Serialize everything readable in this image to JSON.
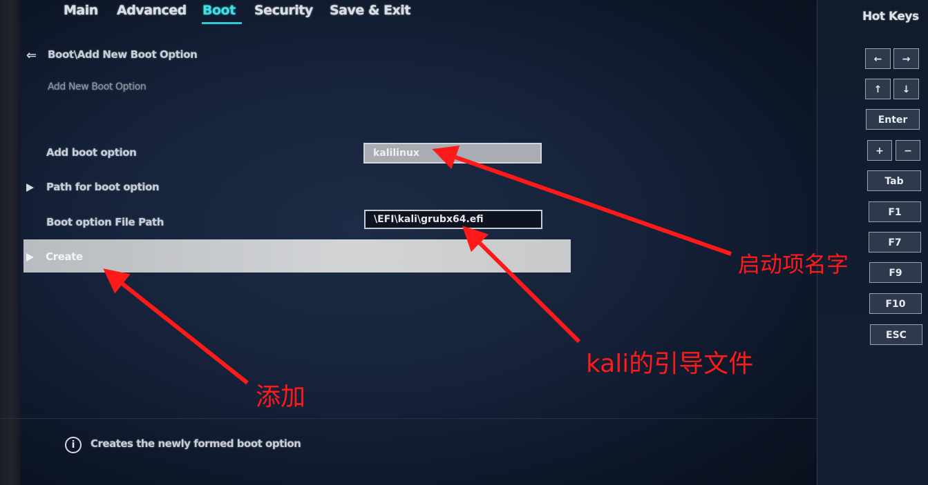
{
  "tabs": [
    {
      "label": "Main"
    },
    {
      "label": "Advanced"
    },
    {
      "label": "Boot"
    },
    {
      "label": "Security"
    },
    {
      "label": "Save & Exit"
    }
  ],
  "active_tab": "Boot",
  "breadcrumb": "Boot\\Add New Boot Option",
  "section_title": "Add New Boot Option",
  "form": {
    "add_boot_option_label": "Add boot option",
    "add_boot_option_value": "kalilinux",
    "path_label": "Path for boot option",
    "file_path_label": "Boot option File Path",
    "file_path_value": "\\EFI\\kali\\grubx64.efi",
    "create_label": "Create"
  },
  "help": {
    "icon": "info-icon",
    "text": "Creates the newly formed boot option"
  },
  "hotkeys": {
    "title": "Hot Keys",
    "keys": {
      "left": "←",
      "right": "→",
      "up": "↑",
      "down": "↓",
      "enter": "Enter",
      "plus": "+",
      "minus": "−",
      "tab": "Tab",
      "f1": "F1",
      "f7": "F7",
      "f9": "F9",
      "f10": "F10",
      "esc": "ESC"
    }
  },
  "annotations": {
    "boot_name": "启动项名字",
    "boot_file": "kali的引导文件",
    "add": "添加",
    "color": "#ff1a1a"
  }
}
